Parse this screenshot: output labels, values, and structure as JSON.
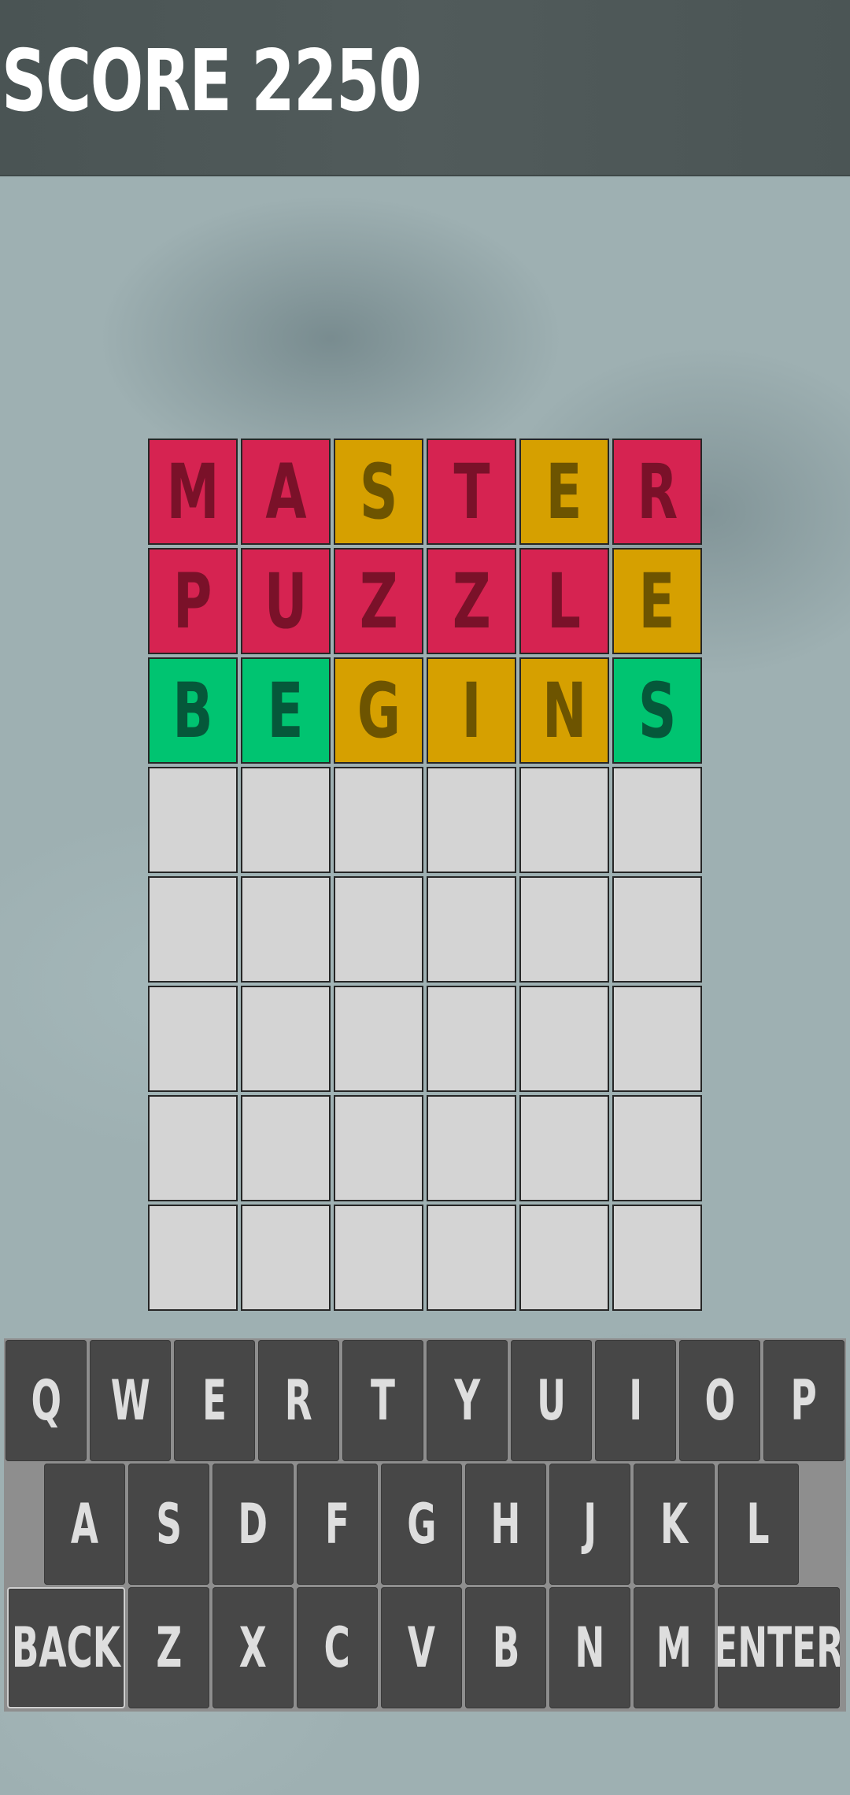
{
  "header": {
    "score_label": "SCORE 2250"
  },
  "board": {
    "rows": [
      [
        {
          "letter": "M",
          "state": "absent"
        },
        {
          "letter": "A",
          "state": "absent"
        },
        {
          "letter": "S",
          "state": "present"
        },
        {
          "letter": "T",
          "state": "absent"
        },
        {
          "letter": "E",
          "state": "present"
        },
        {
          "letter": "R",
          "state": "absent"
        }
      ],
      [
        {
          "letter": "P",
          "state": "absent"
        },
        {
          "letter": "U",
          "state": "absent"
        },
        {
          "letter": "Z",
          "state": "absent"
        },
        {
          "letter": "Z",
          "state": "absent"
        },
        {
          "letter": "L",
          "state": "absent"
        },
        {
          "letter": "E",
          "state": "present"
        }
      ],
      [
        {
          "letter": "B",
          "state": "correct"
        },
        {
          "letter": "E",
          "state": "correct"
        },
        {
          "letter": "G",
          "state": "present"
        },
        {
          "letter": "I",
          "state": "present"
        },
        {
          "letter": "N",
          "state": "present"
        },
        {
          "letter": "S",
          "state": "correct"
        }
      ],
      [
        {
          "letter": "",
          "state": "empty"
        },
        {
          "letter": "",
          "state": "empty"
        },
        {
          "letter": "",
          "state": "empty"
        },
        {
          "letter": "",
          "state": "empty"
        },
        {
          "letter": "",
          "state": "empty"
        },
        {
          "letter": "",
          "state": "empty"
        }
      ],
      [
        {
          "letter": "",
          "state": "empty"
        },
        {
          "letter": "",
          "state": "empty"
        },
        {
          "letter": "",
          "state": "empty"
        },
        {
          "letter": "",
          "state": "empty"
        },
        {
          "letter": "",
          "state": "empty"
        },
        {
          "letter": "",
          "state": "empty"
        }
      ],
      [
        {
          "letter": "",
          "state": "empty"
        },
        {
          "letter": "",
          "state": "empty"
        },
        {
          "letter": "",
          "state": "empty"
        },
        {
          "letter": "",
          "state": "empty"
        },
        {
          "letter": "",
          "state": "empty"
        },
        {
          "letter": "",
          "state": "empty"
        }
      ],
      [
        {
          "letter": "",
          "state": "empty"
        },
        {
          "letter": "",
          "state": "empty"
        },
        {
          "letter": "",
          "state": "empty"
        },
        {
          "letter": "",
          "state": "empty"
        },
        {
          "letter": "",
          "state": "empty"
        },
        {
          "letter": "",
          "state": "empty"
        }
      ],
      [
        {
          "letter": "",
          "state": "empty"
        },
        {
          "letter": "",
          "state": "empty"
        },
        {
          "letter": "",
          "state": "empty"
        },
        {
          "letter": "",
          "state": "empty"
        },
        {
          "letter": "",
          "state": "empty"
        },
        {
          "letter": "",
          "state": "empty"
        }
      ]
    ]
  },
  "keyboard": {
    "rows": [
      [
        "Q",
        "W",
        "E",
        "R",
        "T",
        "Y",
        "U",
        "I",
        "O",
        "P"
      ],
      [
        "A",
        "S",
        "D",
        "F",
        "G",
        "H",
        "J",
        "K",
        "L"
      ],
      [
        "BACK",
        "Z",
        "X",
        "C",
        "V",
        "B",
        "N",
        "M",
        "ENTER"
      ]
    ]
  },
  "colors": {
    "absent": "#d62351",
    "present": "#d6a000",
    "correct": "#00c471",
    "empty": "#d4d4d4",
    "key": "#474747",
    "keyboard_bg": "#8e8e8e",
    "header_bg": "#4f5959"
  }
}
